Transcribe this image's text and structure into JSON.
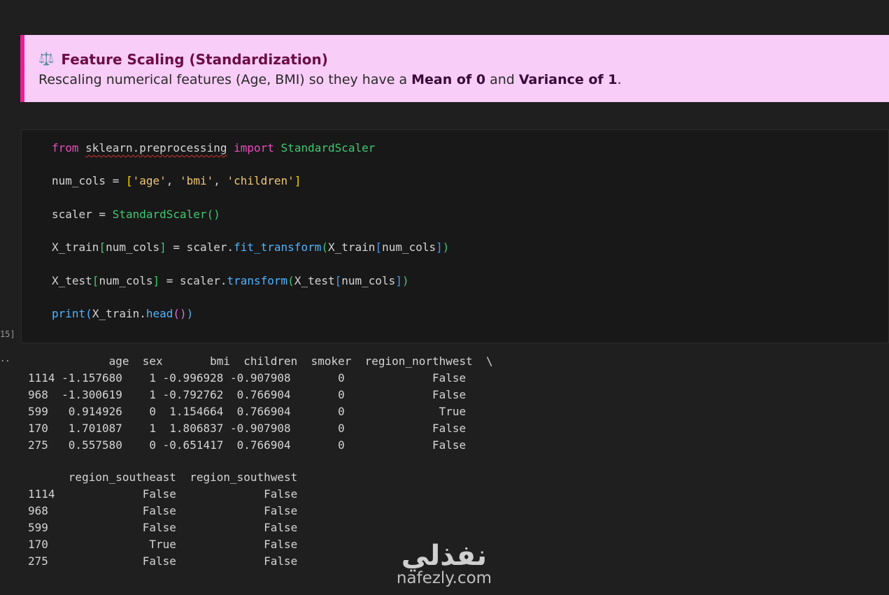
{
  "markdown": {
    "emoji": "⚖️",
    "title": "Feature Scaling (Standardization)",
    "desc_1": "Rescaling numerical features (Age, BMI) so they have a ",
    "desc_bold_1": "Mean of 0",
    "desc_2": " and ",
    "desc_bold_2": "Variance of 1",
    "desc_3": "."
  },
  "code": {
    "l1": {
      "t1": "from",
      "t2": " ",
      "t3": "sklearn.preprocessing",
      "t4": " ",
      "t5": "import",
      "t6": " ",
      "t7": "StandardScaler"
    },
    "l2": {
      "t1": "num_cols = ",
      "t2": "[",
      "t3": "'age'",
      "t4": ", ",
      "t5": "'bmi'",
      "t6": ", ",
      "t7": "'children'",
      "t8": "]"
    },
    "l3": {
      "t1": "scaler = ",
      "t2": "StandardScaler",
      "t3": "(",
      "t4": ")"
    },
    "l4": {
      "t1": "X_train",
      "t2": "[",
      "t3": "num_cols",
      "t4": "]",
      "t5": " = scaler.",
      "t6": "fit_transform",
      "t7": "(",
      "t8": "X_train",
      "t9": "[",
      "t10": "num_cols",
      "t11": "]",
      "t12": ")"
    },
    "l5": {
      "t1": "X_test",
      "t2": "[",
      "t3": "num_cols",
      "t4": "]",
      "t5": " = scaler.",
      "t6": "transform",
      "t7": "(",
      "t8": "X_test",
      "t9": "[",
      "t10": "num_cols",
      "t11": "]",
      "t12": ")"
    },
    "l6": {
      "t1": "print",
      "t2": "(",
      "t3": "X_train.",
      "t4": "head",
      "t5": "(",
      "t6": ")",
      "t7": ")"
    }
  },
  "execution_count": "15]",
  "output_marker": "..",
  "output": {
    "table1_header": "            age  sex       bmi  children  smoker  region_northwest  \\",
    "table1_rows": [
      "1114 -1.157680    1 -0.996928 -0.907908       0             False",
      "968  -1.300619    1 -0.792762  0.766904       0             False",
      "599   0.914926    0  1.154664  0.766904       0              True",
      "170   1.701087    1  1.806837 -0.907908       0             False",
      "275   0.557580    0 -0.651417  0.766904       0             False"
    ],
    "table2_header": "      region_southeast  region_southwest",
    "table2_rows": [
      "1114             False             False",
      "968              False             False",
      "599              False             False",
      "170               True             False",
      "275              False             False"
    ]
  },
  "watermark": {
    "arabic": "نفذلي",
    "latin": "nafezly.com"
  }
}
